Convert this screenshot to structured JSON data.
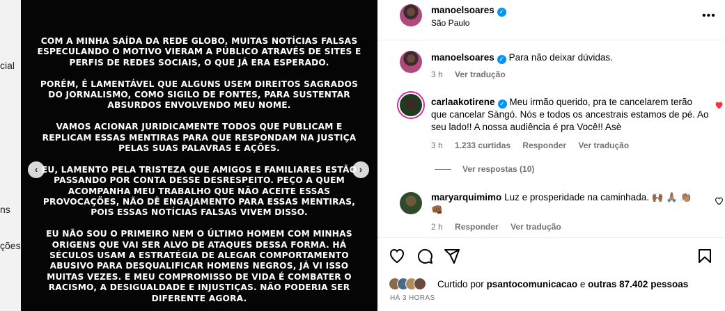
{
  "background_fragments": [
    "cial",
    "ns",
    "ções"
  ],
  "post_image": {
    "paragraphs": [
      "COM A MINHA SAÍDA DA REDE GLOBO, MUITAS NOTÍCIAS FALSAS ESPECULANDO O MOTIVO VIERAM A PÚBLICO ATRAVÉS DE SITES E PERFIS DE REDES SOCIAIS, O QUE JÁ ERA ESPERADO.",
      "PORÉM, É LAMENTÁVEL QUE ALGUNS USEM DIREITOS SAGRADOS DO JORNALISMO, COMO SIGILO DE FONTES, PARA SUSTENTAR ABSURDOS ENVOLVENDO MEU NOME.",
      "VAMOS ACIONAR  JURIDICAMENTE TODOS QUE PUBLICAM E REPLICAM ESSAS MENTIRAS PARA QUE RESPONDAM NA JUSTIÇA PELAS SUAS PALAVRAS E AÇÕES.",
      "EU, LAMENTO PELA TRISTEZA QUE AMIGOS E FAMILIARES ESTÃO PASSANDO POR CONTA DESSE DESRESPEITO. PEÇO A QUEM ACOMPANHA MEU TRABALHO QUE NÃO ACEITE ESSAS PROVOCAÇÕES, NÃO DÊ ENGAJAMENTO PARA ESSAS MENTIRAS, POIS ESSAS NOTÍCIAS FALSAS VIVEM DISSO.",
      "EU NÃO SOU O PRIMEIRO NEM O ÚLTIMO HOMEM COM MINHAS ORIGENS QUE VAI SER ALVO DE ATAQUES DESSA FORMA. HÁ SÉCULOS USAM A ESTRATÉGIA DE ALEGAR COMPORTAMENTO ABUSIVO PARA DESQUALIFICAR HOMENS NEGROS, JÁ VI ISSO MUITAS VEZES. E MEU COMPROMISSO DE VIDA É COMBATER O RACISMO, A DESIGUALDADE E INJUSTIÇAS. NÃO PODERIA SER DIFERENTE AGORA."
    ],
    "prev_arrow": "‹",
    "next_arrow": "›"
  },
  "header": {
    "username": "manoelsoares",
    "location": "São Paulo",
    "more_icon": "•••"
  },
  "caption": {
    "username": "manoelsoares",
    "text": "Para não deixar dúvidas.",
    "time": "3 h",
    "translate": "Ver tradução"
  },
  "comments": [
    {
      "username": "carlaakotirene",
      "text": "Meu irmão querido, pra te cancelarem terão que cancelar Sàngó. Nós e todos os ancestrais estamos de pé. Ao seu lado!! A nossa audiência é pra Você!! Asè",
      "time": "3 h",
      "likes": "1.233 curtidas",
      "reply": "Responder",
      "translate": "Ver tradução",
      "view_replies": "Ver respostas (10)",
      "liked_color": "#ff3040"
    },
    {
      "username": "maryarquimimo",
      "text": "Luz e prosperidade na caminhada.",
      "emojis": "🙌🏾 🙏🏽 👏🏽 👊🏾",
      "time": "2 h",
      "reply": "Responder",
      "translate": "Ver tradução"
    }
  ],
  "likes": {
    "prefix": "Curtido por",
    "user": "psantocomunicacao",
    "middle": "e",
    "others": "outras 87.402 pessoas"
  },
  "time_ago": "HÁ 3 HORAS"
}
